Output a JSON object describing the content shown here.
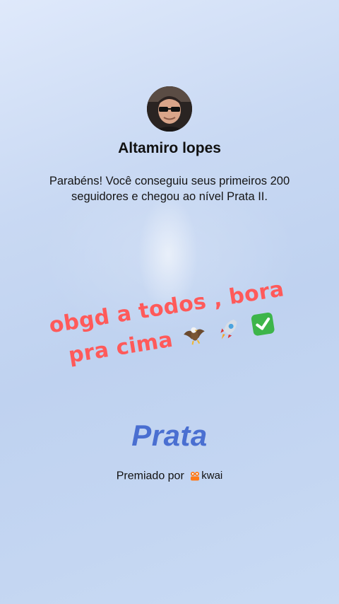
{
  "profile": {
    "name": "Altamiro lopes",
    "message": "Parabéns! Você conseguiu seus primeiros 200 seguidores e chegou ao nível Prata II."
  },
  "caption": {
    "line1": "obgd a todos , bora",
    "line2": "pra cima",
    "emojis": [
      "eagle-emoji",
      "rocket-emoji",
      "check-mark-emoji"
    ],
    "color": "#ff5a5a"
  },
  "level": {
    "name": "Prata",
    "color": "#4a6fd1"
  },
  "awarded": {
    "prefix": "Premiado por",
    "brand": "kwai",
    "brand_color": "#ff7a1a"
  }
}
